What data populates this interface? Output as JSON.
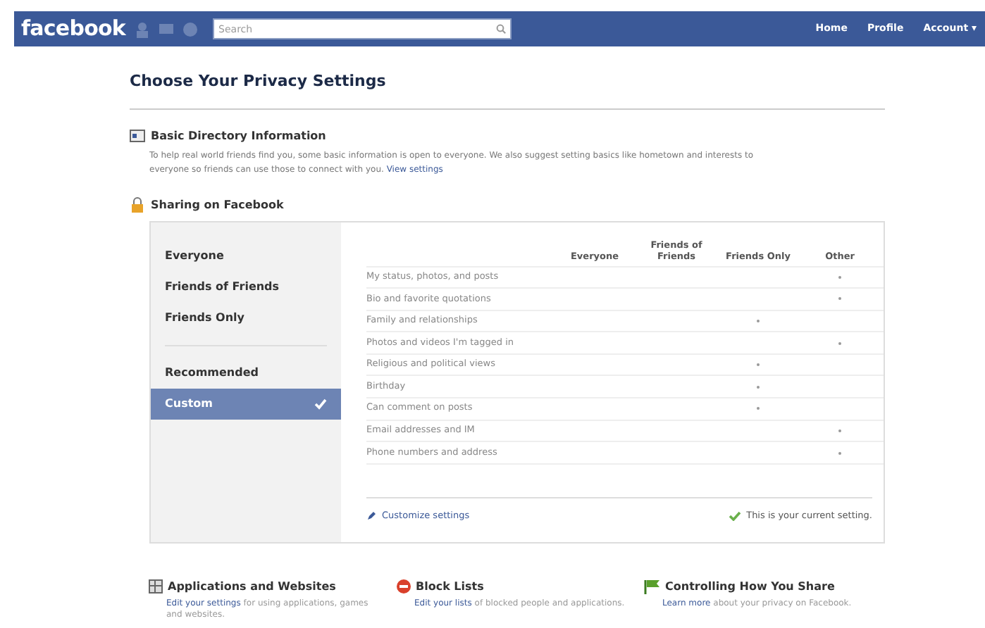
{
  "topbar": {
    "logo": "facebook",
    "search": {
      "placeholder": "Search"
    },
    "links": [
      "Home",
      "Profile",
      "Account ▾"
    ]
  },
  "title": "Choose Your Privacy Settings",
  "basic": {
    "heading": "Basic Directory Information",
    "text": "To help real world friends find you, some basic information is open to everyone. We also suggest setting basics like hometown and interests to everyone so friends can use those to connect with you.",
    "link": "View settings"
  },
  "sharing": {
    "heading": "Sharing on Facebook",
    "option_groups": [
      [
        {
          "label": "Everyone",
          "selected": false
        },
        {
          "label": "Friends of Friends",
          "selected": false
        },
        {
          "label": "Friends Only",
          "selected": false
        }
      ],
      [
        {
          "label": "Recommended",
          "selected": false
        },
        {
          "label": "Custom",
          "selected": true
        }
      ]
    ],
    "columns": [
      "Everyone",
      "Friends of Friends",
      "Friends Only",
      "Other"
    ],
    "rows": [
      {
        "label": "My status, photos, and posts",
        "cells": [
          false,
          false,
          false,
          true
        ]
      },
      {
        "label": "Bio and favorite quotations",
        "cells": [
          false,
          false,
          false,
          true
        ]
      },
      {
        "label": "Family and relationships",
        "cells": [
          false,
          false,
          true,
          false
        ]
      },
      {
        "label": "Photos and videos I'm tagged in",
        "cells": [
          false,
          false,
          false,
          true
        ]
      },
      {
        "label": "Religious and political views",
        "cells": [
          false,
          false,
          true,
          false
        ]
      },
      {
        "label": "Birthday",
        "cells": [
          false,
          false,
          true,
          false
        ]
      },
      {
        "label": "Can comment on posts",
        "cells": [
          false,
          false,
          true,
          false
        ]
      },
      {
        "label": "Email addresses and IM",
        "cells": [
          false,
          false,
          false,
          true
        ]
      },
      {
        "label": "Phone numbers and address",
        "cells": [
          false,
          false,
          false,
          true
        ]
      }
    ],
    "customize": "Customize settings",
    "current": "This is your current setting."
  },
  "bottom": [
    {
      "kind": "apps",
      "heading": "Applications and Websites",
      "link": "Edit your settings",
      "text": "for using applications, games and websites."
    },
    {
      "kind": "block",
      "heading": "Block Lists",
      "link": "Edit your lists",
      "text": "of blocked people and applications."
    },
    {
      "kind": "flag",
      "heading": "Controlling How You Share",
      "link": "Learn more",
      "text": "about your privacy on Facebook."
    }
  ]
}
